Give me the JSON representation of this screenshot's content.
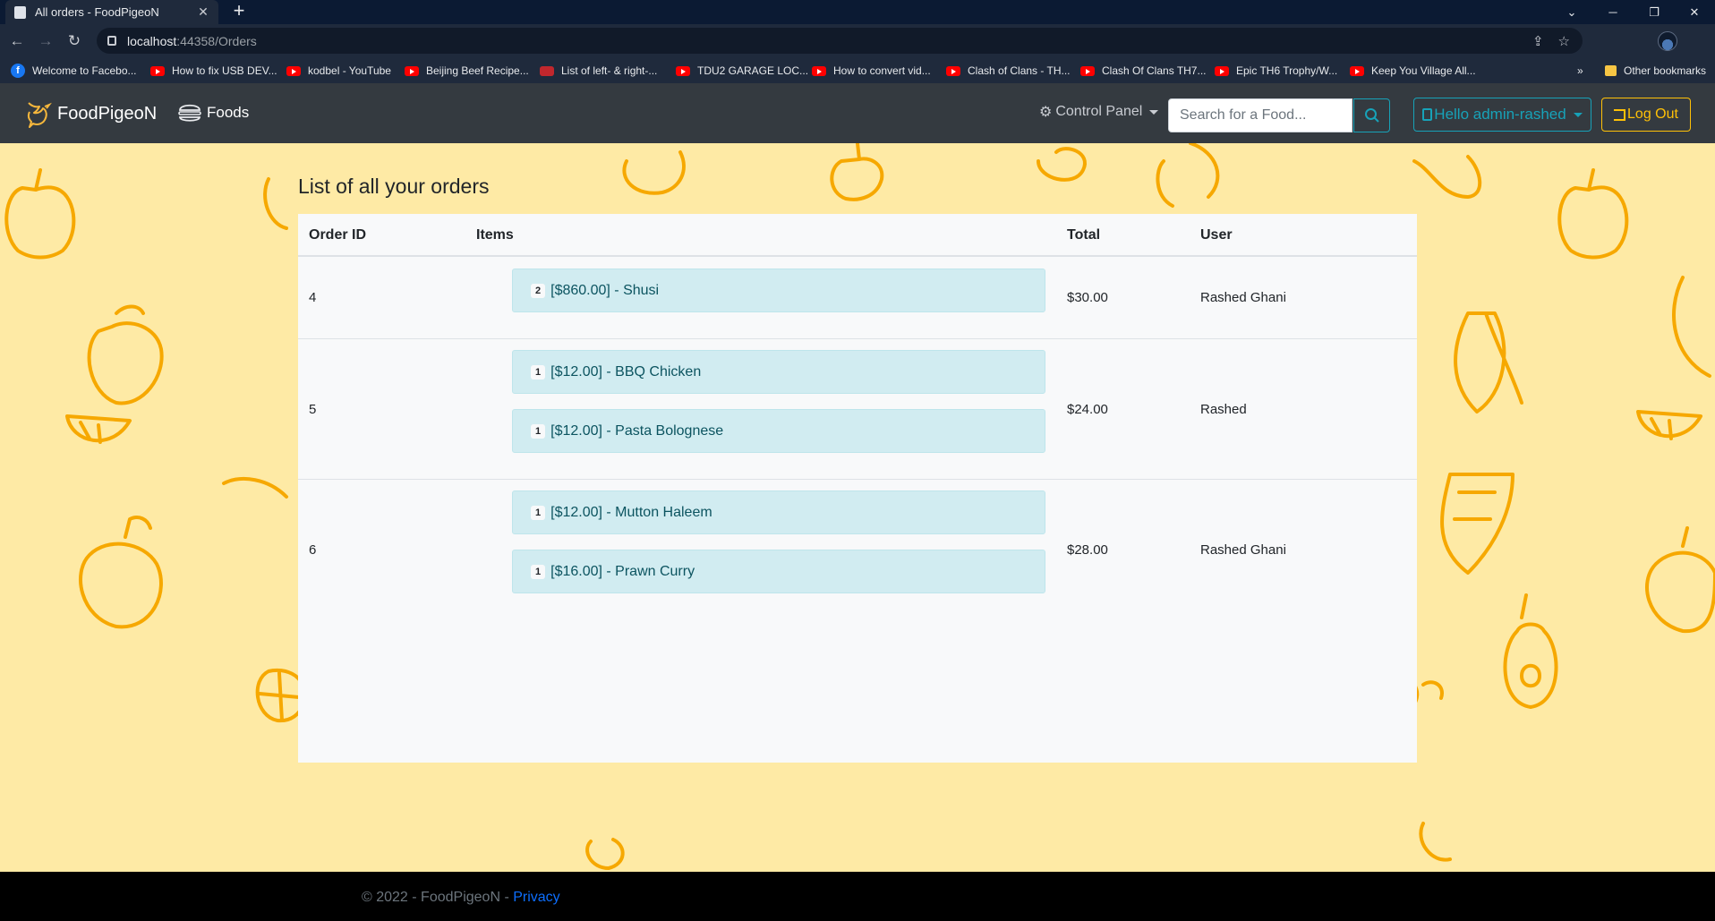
{
  "browser": {
    "tab_title": "All orders - FoodPigeoN",
    "url_host": "localhost",
    "url_path": ":44358/Orders",
    "bookmarks": [
      {
        "label": "Welcome to Facebo...",
        "icon": "facebook-icon"
      },
      {
        "label": "How to fix USB DEV...",
        "icon": "youtube-icon"
      },
      {
        "label": "kodbel - YouTube",
        "icon": "youtube-icon"
      },
      {
        "label": "Beijing Beef Recipe...",
        "icon": "youtube-icon"
      },
      {
        "label": "List of left- & right-...",
        "icon": "stackoverflow-icon"
      },
      {
        "label": "TDU2 GARAGE LOC...",
        "icon": "youtube-icon"
      },
      {
        "label": "How to convert vid...",
        "icon": "youtube-icon"
      },
      {
        "label": "Clash of Clans - TH...",
        "icon": "youtube-icon"
      },
      {
        "label": "Clash Of Clans TH7...",
        "icon": "youtube-icon"
      },
      {
        "label": "Epic TH6 Trophy/W...",
        "icon": "youtube-icon"
      },
      {
        "label": "Keep You Village All...",
        "icon": "youtube-icon"
      }
    ],
    "more_bookmarks": "»",
    "other_bookmarks": "Other bookmarks"
  },
  "navbar": {
    "brand": "FoodPigeoN",
    "foods_link": "Foods",
    "control_panel": "Control Panel",
    "search_placeholder": "Search for a Food...",
    "hello": "Hello admin-rashed",
    "logout": "Log Out"
  },
  "page": {
    "heading": "List of all your orders",
    "columns": [
      "Order ID",
      "Items",
      "Total",
      "User"
    ],
    "orders": [
      {
        "id": "4",
        "items": [
          {
            "qty": "2",
            "text": "[$860.00] - Shusi"
          }
        ],
        "total": "$30.00",
        "user": "Rashed Ghani"
      },
      {
        "id": "5",
        "items": [
          {
            "qty": "1",
            "text": "[$12.00] - BBQ Chicken"
          },
          {
            "qty": "1",
            "text": "[$12.00] - Pasta Bolognese"
          }
        ],
        "total": "$24.00",
        "user": "Rashed"
      },
      {
        "id": "6",
        "items": [
          {
            "qty": "1",
            "text": "[$12.00] - Mutton Haleem"
          },
          {
            "qty": "1",
            "text": "[$16.00] - Prawn Curry"
          }
        ],
        "total": "$28.00",
        "user": "Rashed Ghani"
      }
    ]
  },
  "footer": {
    "text": "© 2022 - FoodPigeoN - ",
    "privacy": "Privacy"
  },
  "colors": {
    "navbar_bg": "#343a40",
    "page_bg": "#feeaa5",
    "fruit_outline": "#f6a800",
    "item_bg": "#d1ecf1",
    "item_text": "#0c5460",
    "info": "#17a2b8",
    "warning": "#ffc107"
  }
}
